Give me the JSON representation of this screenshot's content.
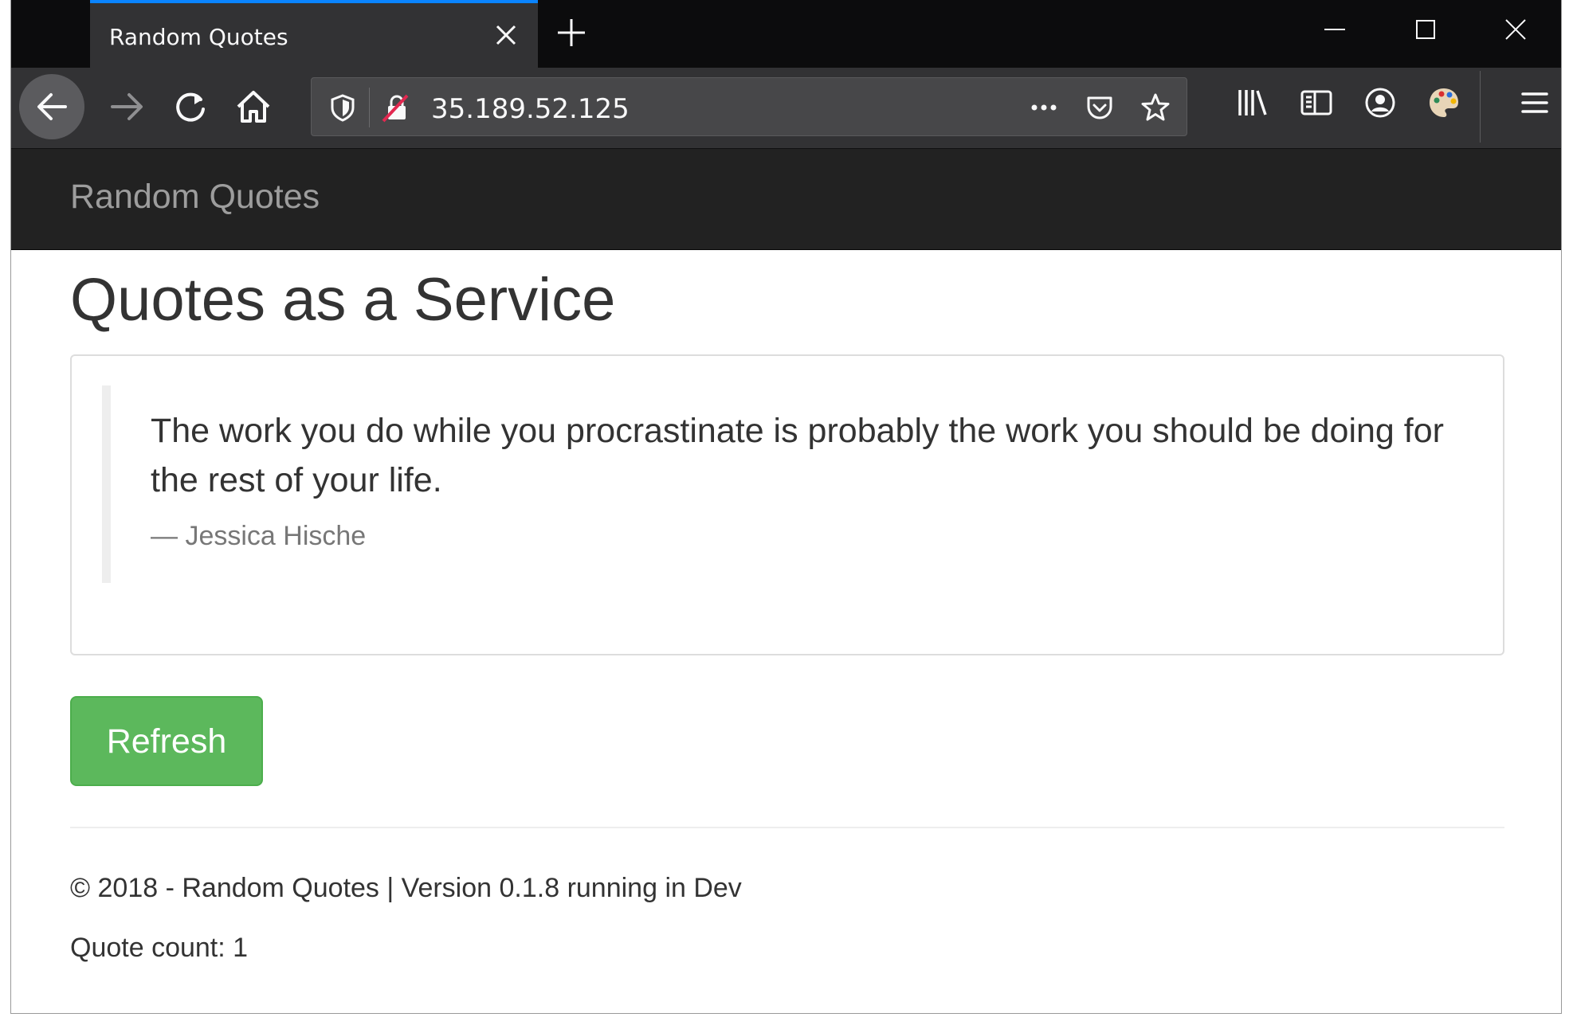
{
  "browser": {
    "tab_title": "Random Quotes",
    "url": "35.189.52.125",
    "icons": {
      "tab_close": "close-icon",
      "new_tab": "plus-icon",
      "minimize": "minimize-icon",
      "maximize": "maximize-icon",
      "close_window": "close-icon",
      "back": "arrow-left-icon",
      "forward": "arrow-right-icon",
      "reload": "reload-icon",
      "home": "home-icon",
      "tracking": "shield-icon",
      "insecure": "insecure-lock-icon",
      "page_actions": "ellipsis-icon",
      "pocket": "pocket-icon",
      "bookmark": "star-icon",
      "library": "library-icon",
      "sidebar": "sidebar-icon",
      "account": "account-icon",
      "theme": "palette-icon",
      "menu": "hamburger-icon"
    }
  },
  "site": {
    "brand": "Random Quotes",
    "title": "Quotes as a Service",
    "quote": {
      "text": "The work you do while you procrastinate is probably the work you should be doing for the rest of your life.",
      "author": "— Jessica Hische"
    },
    "refresh_label": "Refresh",
    "footer": {
      "copyright": "© 2018 - Random Quotes | Version 0.1.8 running in Dev",
      "count": "Quote count: 1"
    }
  },
  "colors": {
    "tab_accent": "#0a84ff",
    "navbar_bg": "#222222",
    "button_green": "#5cb85c"
  }
}
